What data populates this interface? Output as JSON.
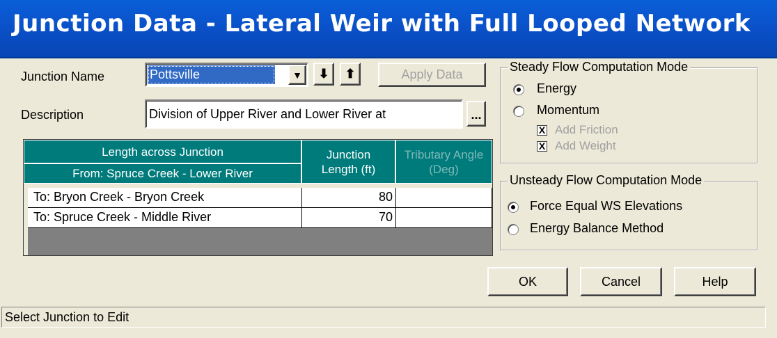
{
  "window": {
    "title": "Junction Data - Lateral Weir with Full Looped Network"
  },
  "form": {
    "junction_name_label": "Junction Name",
    "junction_name_value": "Pottsville",
    "down_arrow": "⬇",
    "up_arrow": "⬆",
    "apply_label": "Apply Data",
    "description_label": "Description",
    "description_value": "Division of Upper River and Lower River at",
    "ellipsis": "..."
  },
  "table": {
    "header_top": "Length across Junction",
    "header_from": "From: Spruce Creek - Lower River",
    "header_length": "Junction Length (ft)",
    "header_angle": "Tributary Angle (Deg)",
    "rows": [
      {
        "to": "To: Bryon Creek - Bryon Creek",
        "length": "80",
        "angle": ""
      },
      {
        "to": "To: Spruce Creek - Middle River",
        "length": "70",
        "angle": ""
      }
    ]
  },
  "steady": {
    "legend": "Steady Flow Computation Mode",
    "energy_label": "Energy",
    "momentum_label": "Momentum",
    "add_friction_label": "Add Friction",
    "add_weight_label": "Add Weight",
    "check_mark": "X",
    "selected": "Energy"
  },
  "unsteady": {
    "legend": "Unsteady Flow Computation Mode",
    "force_label": "Force Equal WS Elevations",
    "energy_balance_label": "Energy Balance Method",
    "selected": "Force Equal WS Elevations"
  },
  "buttons": {
    "ok": "OK",
    "cancel": "Cancel",
    "help": "Help"
  },
  "status": {
    "text": "Select Junction to Edit"
  },
  "colors": {
    "title_bar": "#0a50c8",
    "table_header": "#007b7b",
    "selection": "#316ac5",
    "dialog": "#ece9d8"
  }
}
